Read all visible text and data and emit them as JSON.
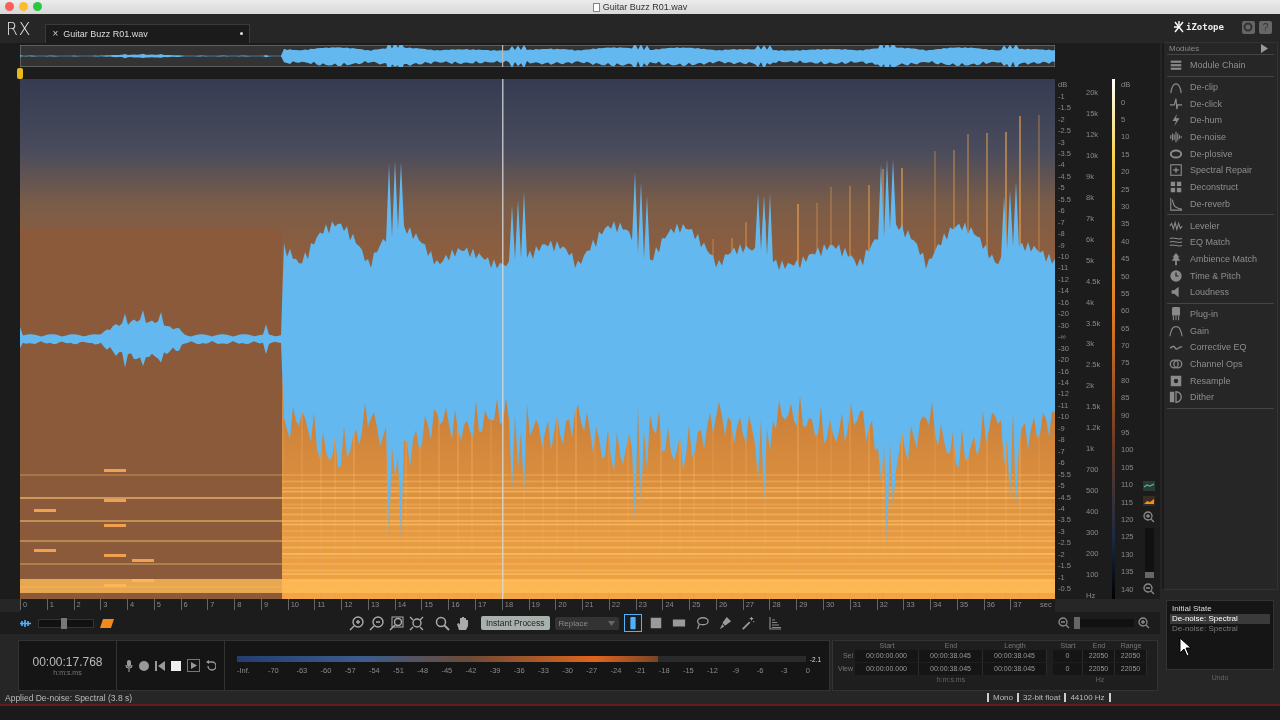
{
  "window": {
    "title": "Guitar Buzz R01.wav"
  },
  "app_logo": "RX",
  "tabs": [
    {
      "label": "Guitar Buzz R01.wav",
      "close": "×",
      "selected": true
    }
  ],
  "brand": "iZotope",
  "help_button": "?",
  "amplitude_scale": {
    "unit": "dB",
    "ticks": [
      "-1",
      "-1.5",
      "-2",
      "-2.5",
      "-3",
      "-3.5",
      "-4",
      "-4.5",
      "-5",
      "-5.5",
      "-6",
      "-7",
      "-8",
      "-9",
      "-10",
      "-11",
      "-12",
      "-14",
      "-16",
      "-20",
      "-30",
      "-∞",
      "-30",
      "-20",
      "-16",
      "-14",
      "-12",
      "-11",
      "-10",
      "-9",
      "-8",
      "-7",
      "-6",
      "-5.5",
      "-5",
      "-4.5",
      "-4",
      "-3.5",
      "-3",
      "-2.5",
      "-2",
      "-1.5",
      "-1",
      "-0.5"
    ]
  },
  "frequency_scale": {
    "unit": "Hz",
    "ticks": [
      "20k",
      "15k",
      "12k",
      "10k",
      "9k",
      "8k",
      "7k",
      "6k",
      "5k",
      "4.5k",
      "4k",
      "3.5k",
      "3k",
      "2.5k",
      "2k",
      "1.5k",
      "1.2k",
      "1k",
      "700",
      "500",
      "400",
      "300",
      "200",
      "100"
    ]
  },
  "color_scale": {
    "unit": "dB",
    "ticks": [
      "0",
      "5",
      "10",
      "15",
      "20",
      "25",
      "30",
      "35",
      "40",
      "45",
      "50",
      "55",
      "60",
      "65",
      "70",
      "75",
      "80",
      "85",
      "90",
      "95",
      "100",
      "105",
      "110",
      "115",
      "120",
      "125",
      "130",
      "135",
      "140"
    ]
  },
  "time_axis": {
    "ticks": [
      "0",
      "1",
      "2",
      "3",
      "4",
      "5",
      "6",
      "7",
      "8",
      "9",
      "10",
      "11",
      "12",
      "13",
      "14",
      "15",
      "16",
      "17",
      "18",
      "19",
      "20",
      "21",
      "22",
      "23",
      "24",
      "25",
      "26",
      "27",
      "28",
      "29",
      "30",
      "31",
      "32",
      "33",
      "34",
      "35",
      "36",
      "37"
    ],
    "unit": "sec"
  },
  "view_blend": {
    "level": 0.45
  },
  "vertical_zoom": {
    "level": 0
  },
  "horizontal_zoom": {
    "level": 0
  },
  "toolbar": {
    "instant_process": "Instant Process",
    "output_mode": {
      "value": "Replace",
      "disabled": true
    },
    "tools": [
      {
        "selected": true
      },
      {
        "selected": false
      },
      {
        "selected": false
      },
      {
        "selected": false
      },
      {
        "selected": false
      },
      {
        "selected": false
      }
    ]
  },
  "transport": {
    "time": "00:00:17.768",
    "time_format": "h:m:s.ms"
  },
  "meter": {
    "level": 0.74,
    "reading": "-2.1",
    "scale": [
      "-Inf.",
      "-70",
      "-63",
      "-60",
      "-57",
      "-54",
      "-51",
      "-48",
      "-45",
      "-42",
      "-39",
      "-36",
      "-33",
      "-30",
      "-27",
      "-24",
      "-21",
      "-18",
      "-15",
      "-12",
      "-9",
      "-6",
      "-3",
      "0"
    ]
  },
  "selection": {
    "columns": [
      "Start",
      "End",
      "Length"
    ],
    "rows": [
      {
        "label": "Sel",
        "values": [
          "00:00:00.000",
          "00:00:38.045",
          "00:00:38.045"
        ],
        "freq": [
          "0",
          "22050",
          "22050"
        ]
      },
      {
        "label": "View",
        "values": [
          "00:00:00.000",
          "00:00:38.045",
          "00:00:38.045"
        ],
        "freq": [
          "0",
          "22050",
          "22050"
        ]
      }
    ],
    "unit": "h:m:s.ms",
    "freq_columns": [
      "Start",
      "End",
      "Range"
    ],
    "freq_unit": "Hz"
  },
  "modules": {
    "title": "Modules",
    "groups": [
      [
        "Module Chain"
      ],
      [
        "De-clip",
        "De-click",
        "De-hum",
        "De-noise",
        "De-plosive",
        "Spectral Repair",
        "Deconstruct",
        "De-reverb"
      ],
      [
        "Leveler",
        "EQ Match",
        "Ambience Match",
        "Time & Pitch",
        "Loudness"
      ],
      [
        "Plug-in",
        "Gain",
        "Corrective EQ",
        "Channel Ops",
        "Resample",
        "Dither"
      ]
    ]
  },
  "history": {
    "items": [
      {
        "label": "Initial State",
        "selected": false,
        "disabled": false
      },
      {
        "label": "De-noise: Spectral",
        "selected": true,
        "disabled": false
      },
      {
        "label": "De-noise: Spectral",
        "selected": false,
        "disabled": true
      }
    ],
    "footer": "Undo"
  },
  "status": {
    "message": "Applied De-noise: Spectral (3.8 s)",
    "format": [
      "Mono",
      "32-bit float",
      "44100 Hz"
    ]
  }
}
